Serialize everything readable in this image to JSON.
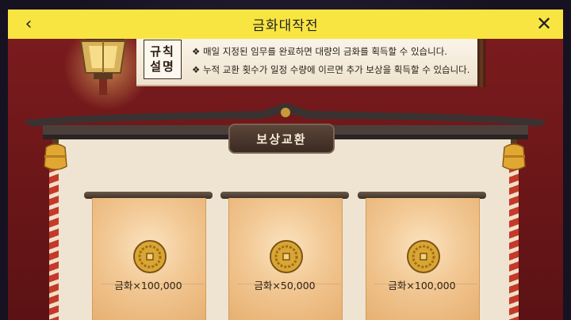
{
  "header": {
    "title": "금화대작전",
    "back_icon": "chevron-left-icon",
    "close_icon": "close-icon"
  },
  "rules": {
    "badge_line1": "규칙",
    "badge_line2": "설명",
    "items": [
      "❖ 매일 지정된 임무를 완료하면 대량의 금화를 획득할 수 있습니다.",
      "❖ 누적 교환 횟수가 일정 수량에 이르면 추가 보상을 획득할 수 있습니다."
    ]
  },
  "section": {
    "title": "보상교환"
  },
  "rewards": [
    {
      "label": "금화×100,000",
      "icon": "gold-coin-icon"
    },
    {
      "label": "금화×50,000",
      "icon": "gold-coin-icon"
    },
    {
      "label": "금화×100,000",
      "icon": "gold-coin-icon"
    }
  ],
  "colors": {
    "header_bg": "#f8e541",
    "stage_red": "#7d1c1f",
    "board_bg": "#efe4d1",
    "banner_gold": "#f2c894"
  }
}
